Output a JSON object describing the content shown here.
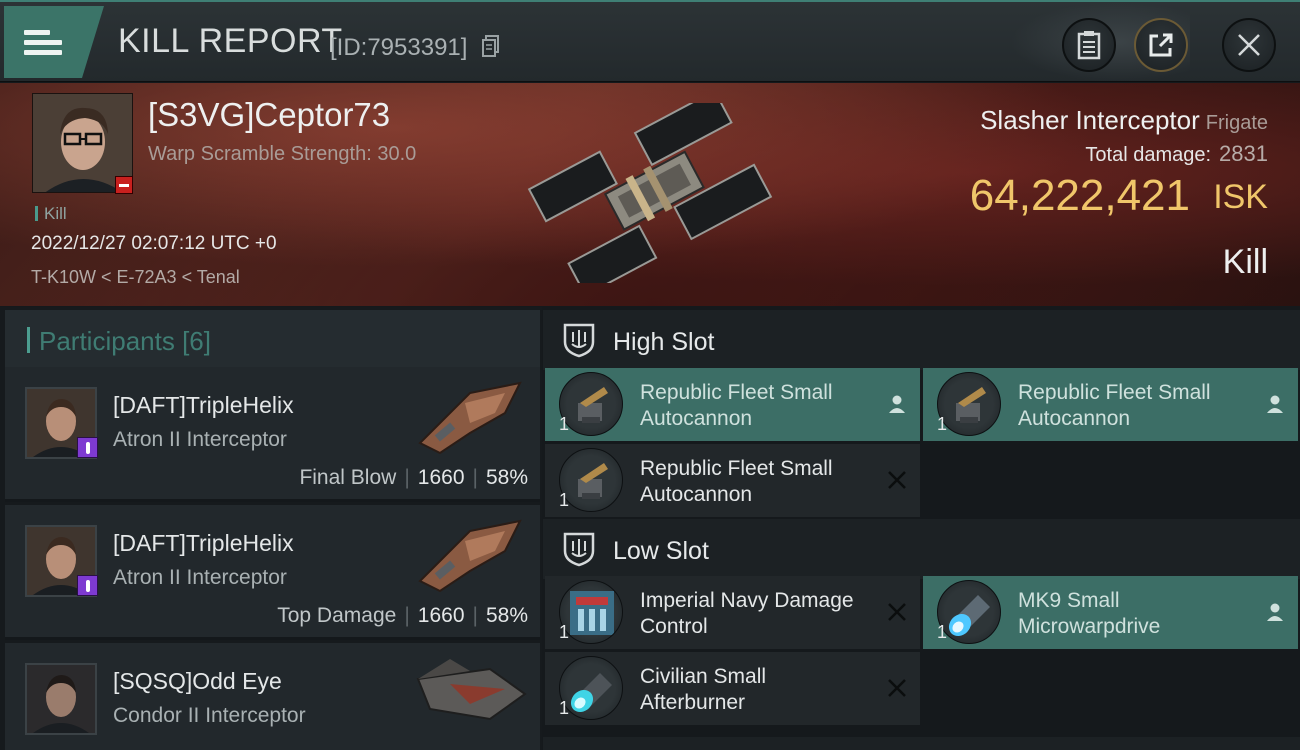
{
  "header": {
    "title": "KILL REPORT",
    "report_id": "[ID:7953391]"
  },
  "victim": {
    "name": "[S3VG]Ceptor73",
    "warp_scramble": "Warp Scramble Strength: 30.0",
    "kill_tag": "Kill",
    "time": "2022/12/27 02:07:12 UTC +0",
    "location": "T-K10W < E-72A3 < Tenal",
    "ship_name": "Slasher Interceptor",
    "ship_class": "Frigate",
    "total_damage_label": "Total damage:",
    "total_damage_value": "2831",
    "isk_value": "64,222,421",
    "isk_unit": "ISK",
    "result": "Kill"
  },
  "participants": {
    "title": "Participants [6]",
    "rows": [
      {
        "name": "[DAFT]TripleHelix",
        "ship": "Atron II Interceptor",
        "role": "Final Blow",
        "damage": "1660",
        "percent": "58%"
      },
      {
        "name": "[DAFT]TripleHelix",
        "ship": "Atron II Interceptor",
        "role": "Top Damage",
        "damage": "1660",
        "percent": "58%"
      },
      {
        "name": "[SQSQ]Odd Eye",
        "ship": "Condor II Interceptor",
        "role": "",
        "damage": "",
        "percent": ""
      }
    ]
  },
  "fitting": {
    "high_slot": {
      "title": "High Slot",
      "modules": [
        {
          "qty": "1",
          "name": "Republic Fleet Small Autocannon",
          "status": "fitted"
        },
        {
          "qty": "1",
          "name": "Republic Fleet Small Autocannon",
          "status": "fitted"
        },
        {
          "qty": "1",
          "name": "Republic Fleet Small Autocannon",
          "status": "destroyed"
        }
      ]
    },
    "low_slot": {
      "title": "Low Slot",
      "modules": [
        {
          "qty": "1",
          "name": "Imperial Navy Damage Control",
          "status": "destroyed"
        },
        {
          "qty": "1",
          "name": "MK9 Small Microwarpdrive",
          "status": "fitted"
        },
        {
          "qty": "1",
          "name": "Civilian Small Afterburner",
          "status": "destroyed"
        }
      ]
    }
  },
  "colors": {
    "accent": "#3c6e66",
    "isk": "#f0c66a",
    "badge_purple": "#7e3ad1",
    "victim_flag": "#c8201e"
  },
  "icons": {
    "menu": "hamburger-menu-icon",
    "copy": "copy-icon",
    "clipboard": "clipboard-icon",
    "share": "share-icon",
    "close": "close-icon",
    "slot": "slot-shield-icon",
    "fitted": "person-icon",
    "destroyed": "cross-icon"
  }
}
